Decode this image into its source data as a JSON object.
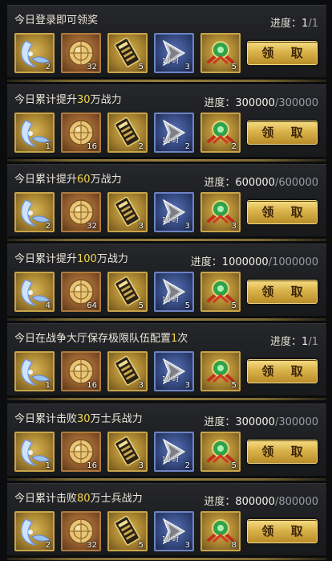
{
  "claim_label": "领 取",
  "rows": [
    {
      "title_pre": "今日登录即可领奖",
      "title_hl": "",
      "title_post": "",
      "progress_label": "进度：",
      "progress_cur": "1",
      "progress_sep": "/",
      "progress_max": "1",
      "items": [
        {
          "icon": "blue-crescent-blade-icon",
          "count": "2"
        },
        {
          "icon": "golden-orb-icon",
          "count": "32"
        },
        {
          "icon": "gold-scroll-icon",
          "count": "5"
        },
        {
          "icon": "speedup-arrow-icon",
          "tag": "1小时",
          "count": "3"
        },
        {
          "icon": "jade-medallion-icon",
          "count": "5"
        }
      ]
    },
    {
      "title_pre": "今日累计提升",
      "title_hl": "30",
      "title_post": "万战力",
      "progress_label": "进度：",
      "progress_cur": "300000",
      "progress_sep": "/",
      "progress_max": "300000",
      "items": [
        {
          "icon": "blue-crescent-blade-icon",
          "count": "1"
        },
        {
          "icon": "golden-orb-icon",
          "count": "16"
        },
        {
          "icon": "gold-scroll-icon",
          "count": "2"
        },
        {
          "icon": "speedup-arrow-icon",
          "tag": "1小时",
          "count": "2"
        },
        {
          "icon": "jade-medallion-icon",
          "count": "2"
        }
      ]
    },
    {
      "title_pre": "今日累计提升",
      "title_hl": "60",
      "title_post": "万战力",
      "progress_label": "进度：",
      "progress_cur": "600000",
      "progress_sep": "/",
      "progress_max": "600000",
      "items": [
        {
          "icon": "blue-crescent-blade-icon",
          "count": "2"
        },
        {
          "icon": "golden-orb-icon",
          "count": "32"
        },
        {
          "icon": "gold-scroll-icon",
          "count": "3"
        },
        {
          "icon": "speedup-arrow-icon",
          "tag": "1小时",
          "count": "3"
        },
        {
          "icon": "jade-medallion-icon",
          "count": "3"
        }
      ]
    },
    {
      "title_pre": "今日累计提升",
      "title_hl": "100",
      "title_post": "万战力",
      "progress_label": "进度：",
      "progress_cur": "1000000",
      "progress_sep": "/",
      "progress_max": "1000000",
      "items": [
        {
          "icon": "blue-crescent-blade-icon",
          "count": "4"
        },
        {
          "icon": "golden-orb-icon",
          "count": "64"
        },
        {
          "icon": "gold-scroll-icon",
          "count": "5"
        },
        {
          "icon": "speedup-arrow-icon",
          "tag": "1小时",
          "count": "5"
        },
        {
          "icon": "jade-medallion-icon",
          "count": "5"
        }
      ]
    },
    {
      "title_pre": "今日在战争大厅保存极限队伍配置",
      "title_hl": "1",
      "title_post": "次",
      "progress_label": "进度：",
      "progress_cur": "1",
      "progress_sep": "/",
      "progress_max": "1",
      "items": [
        {
          "icon": "blue-crescent-blade-icon",
          "count": "1"
        },
        {
          "icon": "golden-orb-icon",
          "count": "16"
        },
        {
          "icon": "gold-scroll-icon",
          "count": "3"
        },
        {
          "icon": "speedup-arrow-icon",
          "tag": "1小时",
          "count": "3"
        },
        {
          "icon": "jade-medallion-icon",
          "count": "5"
        }
      ]
    },
    {
      "title_pre": "今日累计击败",
      "title_hl": "30",
      "title_post": "万士兵战力",
      "progress_label": "进度：",
      "progress_cur": "300000",
      "progress_sep": "/",
      "progress_max": "300000",
      "items": [
        {
          "icon": "blue-crescent-blade-icon",
          "count": "1"
        },
        {
          "icon": "golden-orb-icon",
          "count": "16"
        },
        {
          "icon": "gold-scroll-icon",
          "count": "3"
        },
        {
          "icon": "speedup-arrow-icon",
          "tag": "1小时",
          "count": "2"
        },
        {
          "icon": "jade-medallion-icon",
          "count": "5"
        }
      ]
    },
    {
      "title_pre": "今日累计击败",
      "title_hl": "80",
      "title_post": "万士兵战力",
      "progress_label": "进度：",
      "progress_cur": "800000",
      "progress_sep": "/",
      "progress_max": "800000",
      "items": [
        {
          "icon": "blue-crescent-blade-icon",
          "count": "2"
        },
        {
          "icon": "golden-orb-icon",
          "count": "32"
        },
        {
          "icon": "gold-scroll-icon",
          "count": "5"
        },
        {
          "icon": "speedup-arrow-icon",
          "tag": "1小时",
          "count": "3"
        },
        {
          "icon": "jade-medallion-icon",
          "count": "8"
        }
      ]
    }
  ]
}
